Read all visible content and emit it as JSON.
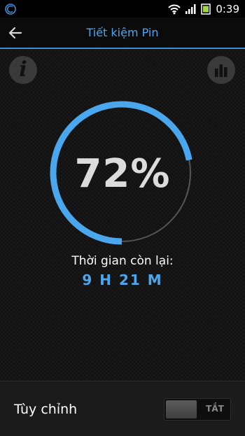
{
  "status_bar": {
    "time": "0:39",
    "icons": [
      "app-notification-icon",
      "wifi-icon",
      "signal-icon",
      "battery-icon"
    ]
  },
  "app_bar": {
    "title": "Tiết kiệm Pin",
    "back_icon": "back-arrow-icon"
  },
  "main": {
    "info_icon": "info-icon",
    "stats_icon": "bar-chart-icon",
    "battery_percent_text": "72%",
    "battery_level": 0.72,
    "remaining_label": "Thời gian còn lại:",
    "remaining_value": "9 H 21 M"
  },
  "bottom": {
    "label": "Tùy chỉnh",
    "toggle_state": "TẮT"
  },
  "colors": {
    "accent": "#4aa7ee",
    "track": "#555555",
    "background": "#101010"
  }
}
